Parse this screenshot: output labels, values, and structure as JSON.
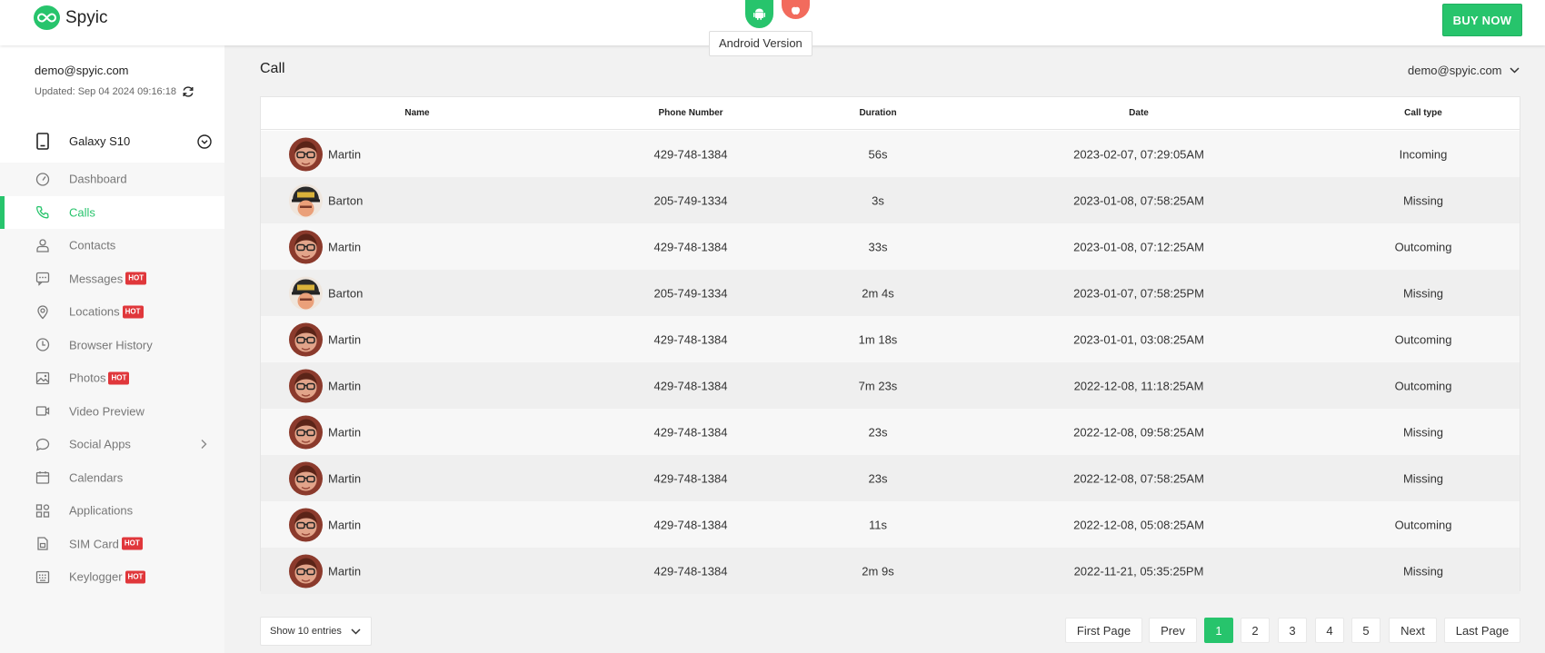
{
  "app": {
    "name": "Spyic"
  },
  "header": {
    "tooltip": "Android Version",
    "buy_label": "BUY NOW",
    "platforms": [
      "android-icon",
      "apple-icon"
    ]
  },
  "account": {
    "email": "demo@spyic.com",
    "updated": "Updated: Sep 04 2024 09:16:18",
    "device": "Galaxy S10"
  },
  "nav": [
    {
      "label": "Dashboard",
      "icon": "gauge-icon",
      "hot": ""
    },
    {
      "label": "Calls",
      "icon": "phone-icon",
      "hot": "",
      "active": true
    },
    {
      "label": "Contacts",
      "icon": "user-icon",
      "hot": ""
    },
    {
      "label": "Messages",
      "icon": "chat-icon",
      "hot": "HOT"
    },
    {
      "label": "Locations",
      "icon": "location-pin-icon",
      "hot": "HOT"
    },
    {
      "label": "Browser History",
      "icon": "clock-icon",
      "hot": ""
    },
    {
      "label": "Photos",
      "icon": "image-icon",
      "hot": "HOT"
    },
    {
      "label": "Video Preview",
      "icon": "video-icon",
      "hot": ""
    },
    {
      "label": "Social Apps",
      "icon": "speech-bubble-icon",
      "hot": "",
      "expand": true
    },
    {
      "label": "Calendars",
      "icon": "calendar-icon",
      "hot": ""
    },
    {
      "label": "Applications",
      "icon": "apps-grid-icon",
      "hot": ""
    },
    {
      "label": "SIM Card",
      "icon": "sim-card-icon",
      "hot": "HOT"
    },
    {
      "label": "Keylogger",
      "icon": "keyboard-icon",
      "hot": "HOT"
    }
  ],
  "main": {
    "title": "Call",
    "account_dropdown": "demo@spyic.com"
  },
  "table": {
    "columns": [
      "Name",
      "Phone Number",
      "Duration",
      "Date",
      "Call type"
    ],
    "rows": [
      {
        "name": "Martin",
        "phone": "429-748-1384",
        "duration": "56s",
        "date": "2023-02-07, 07:29:05AM",
        "type": "Incoming"
      },
      {
        "name": "Barton",
        "phone": "205-749-1334",
        "duration": "3s",
        "date": "2023-01-08, 07:58:25AM",
        "type": "Missing"
      },
      {
        "name": "Martin",
        "phone": "429-748-1384",
        "duration": "33s",
        "date": "2023-01-08, 07:12:25AM",
        "type": "Outcoming"
      },
      {
        "name": "Barton",
        "phone": "205-749-1334",
        "duration": "2m 4s",
        "date": "2023-01-07, 07:58:25PM",
        "type": "Missing"
      },
      {
        "name": "Martin",
        "phone": "429-748-1384",
        "duration": "1m 18s",
        "date": "2023-01-01, 03:08:25AM",
        "type": "Outcoming"
      },
      {
        "name": "Martin",
        "phone": "429-748-1384",
        "duration": "7m 23s",
        "date": "2022-12-08, 11:18:25AM",
        "type": "Outcoming"
      },
      {
        "name": "Martin",
        "phone": "429-748-1384",
        "duration": "23s",
        "date": "2022-12-08, 09:58:25AM",
        "type": "Missing"
      },
      {
        "name": "Martin",
        "phone": "429-748-1384",
        "duration": "23s",
        "date": "2022-12-08, 07:58:25AM",
        "type": "Missing"
      },
      {
        "name": "Martin",
        "phone": "429-748-1384",
        "duration": "11s",
        "date": "2022-12-08, 05:08:25AM",
        "type": "Outcoming"
      },
      {
        "name": "Martin",
        "phone": "429-748-1384",
        "duration": "2m 9s",
        "date": "2022-11-21, 05:35:25PM",
        "type": "Missing"
      }
    ]
  },
  "footer": {
    "entries_label": "Show 10 entries",
    "pagination": [
      "First Page",
      "Prev",
      "1",
      "2",
      "3",
      "4",
      "5",
      "Next",
      "Last Page"
    ],
    "current_page": "1"
  },
  "colors": {
    "accent": "#27c46c",
    "hot": "#e0373b",
    "ios": "#f26b5d"
  }
}
